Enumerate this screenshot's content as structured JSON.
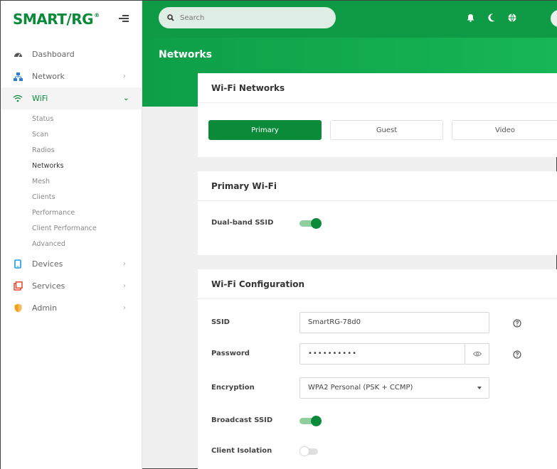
{
  "brand": {
    "name": "SMART/RG",
    "mark": "®"
  },
  "search": {
    "placeholder": "Search"
  },
  "sidebar": {
    "items": [
      {
        "label": "Dashboard",
        "icon": "dashboard-icon"
      },
      {
        "label": "Network",
        "icon": "network-icon"
      },
      {
        "label": "WiFi",
        "icon": "wifi-icon"
      },
      {
        "label": "Devices",
        "icon": "devices-icon"
      },
      {
        "label": "Services",
        "icon": "services-icon"
      },
      {
        "label": "Admin",
        "icon": "admin-icon"
      }
    ],
    "wifi_sub": [
      "Status",
      "Scan",
      "Radios",
      "Networks",
      "Mesh",
      "Clients",
      "Performance",
      "Client Performance",
      "Advanced"
    ]
  },
  "page": {
    "title": "Networks"
  },
  "wifi_networks": {
    "title": "Wi-Fi Networks",
    "tabs": [
      "Primary",
      "Guest",
      "Video"
    ]
  },
  "primary_wifi": {
    "title": "Primary Wi-Fi",
    "dual_band_label": "Dual-band SSID",
    "dual_band_on": true
  },
  "wifi_config": {
    "title": "Wi-Fi Configuration",
    "ssid_label": "SSID",
    "ssid_value": "SmartRG-78d0",
    "password_label": "Password",
    "password_value": "••••••••••",
    "encryption_label": "Encryption",
    "encryption_value": "WPA2 Personal (PSK + CCMP)",
    "broadcast_label": "Broadcast SSID",
    "broadcast_on": true,
    "isolation_label": "Client Isolation",
    "isolation_on": false
  },
  "colors": {
    "accent": "#0b8a3a",
    "topbar": "#0f9b45",
    "devices": "#1e9be0",
    "services": "#e8452c",
    "admin": "#f2a11c"
  }
}
